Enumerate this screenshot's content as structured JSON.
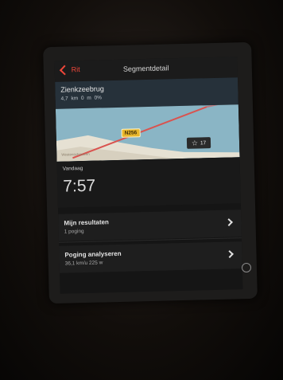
{
  "navbar": {
    "back_label": "Rit",
    "title": "Segmentdetail"
  },
  "segment": {
    "name": "Zienkzeebrug",
    "stats": "4,7 km  0 m  0%"
  },
  "map": {
    "road_label": "N256",
    "place_label": "Westenschouwen",
    "star_count": "17"
  },
  "today": {
    "label": "Vandaag",
    "time": "7:57"
  },
  "rows": [
    {
      "title": "Mijn resultaten",
      "subtitle": "1 poging"
    },
    {
      "title": "Poging analyseren",
      "subtitle": "36,1 km/u 225 w"
    }
  ],
  "colors": {
    "accent": "#f0473a",
    "map_water": "#8ab5c5",
    "map_land": "#e6e1d3",
    "route": "#d9534f"
  }
}
